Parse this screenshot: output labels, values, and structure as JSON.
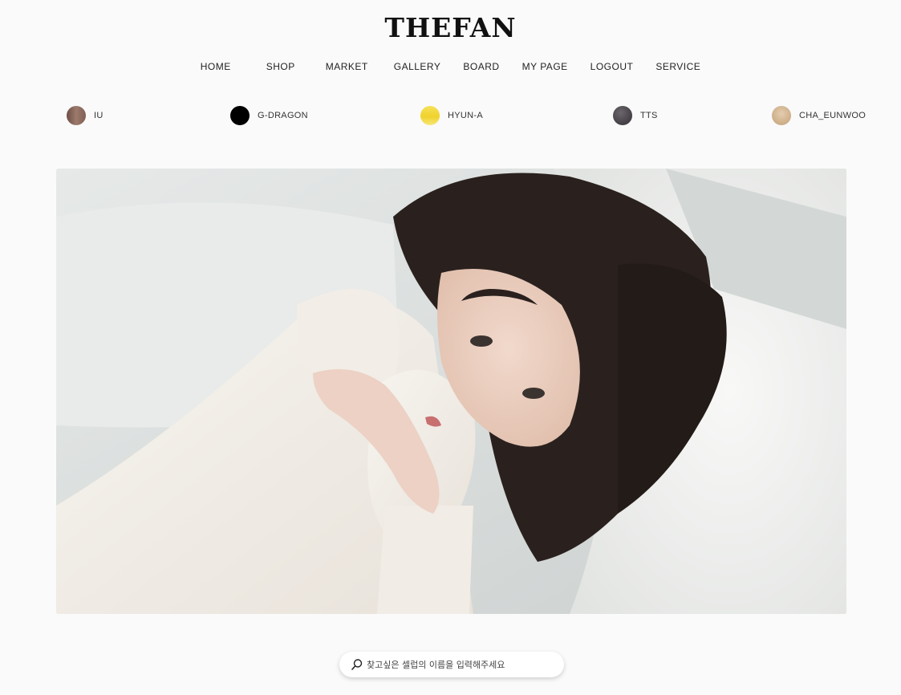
{
  "header": {
    "logo_text": "THEFAN"
  },
  "nav": {
    "items": [
      {
        "label": "HOME"
      },
      {
        "label": "SHOP"
      },
      {
        "label": "MARKET"
      },
      {
        "label": "GALLERY"
      },
      {
        "label": "BOARD"
      },
      {
        "label": "MY PAGE"
      },
      {
        "label": "LOGOUT"
      },
      {
        "label": "SERVICE"
      }
    ]
  },
  "celebs": [
    {
      "label": "IU",
      "color": "#8a6a5e"
    },
    {
      "label": "G-DRAGON",
      "color": "#000000"
    },
    {
      "label": "HYUN-A",
      "color": "#f2d83a"
    },
    {
      "label": "TTS",
      "color": "#4a474c"
    },
    {
      "label": "CHA_EUNWOO",
      "color": "#d6bb98"
    }
  ],
  "hero": {
    "icon": "hero-photo"
  },
  "search": {
    "placeholder": "찾고싶은 셀럽의 이름을 입력해주세요",
    "icon": "search-icon"
  }
}
